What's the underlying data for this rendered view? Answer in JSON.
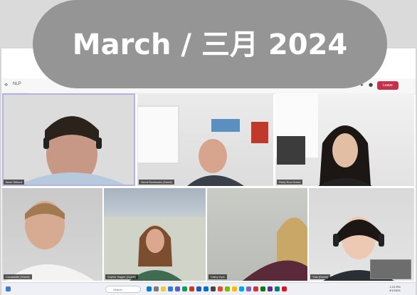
{
  "banner": {
    "date_label": "March / 三月 2024"
  },
  "meeting": {
    "title": "NLP",
    "record_label": "Recording video",
    "leave_label": "Leave",
    "accent_color": "#b6b1e4",
    "leave_color": "#c4314b"
  },
  "participants": [
    {
      "name": "Bene Wilmot"
    },
    {
      "name": "Gerrit Rombouts (Guest)"
    },
    {
      "name": "Ruby Ruo-Guest"
    },
    {
      "name": "Constantin (Guest)"
    },
    {
      "name": "Sophie Hagen (Guest)"
    },
    {
      "name": "Cathy Dyer"
    },
    {
      "name": "Yuki (Guest)"
    }
  ],
  "taskbar": {
    "search_placeholder": "Search",
    "time": "1:23 PM",
    "date": "3/1/2024"
  }
}
